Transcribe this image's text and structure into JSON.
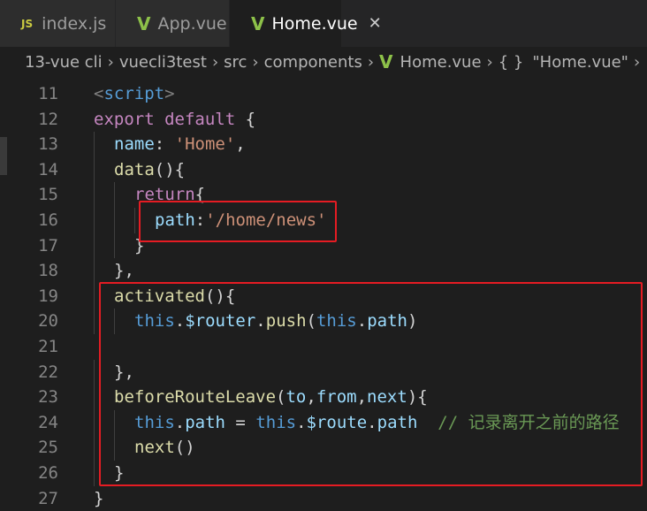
{
  "tabs": [
    {
      "label": "index.js",
      "icon": "js-file-icon",
      "icon_text": "JS",
      "active": false
    },
    {
      "label": "App.vue",
      "icon": "vue-file-icon",
      "active": false
    },
    {
      "label": "Home.vue",
      "icon": "vue-file-icon",
      "active": true,
      "close": "✕"
    }
  ],
  "breadcrumb": {
    "items": [
      "13-vue cli",
      "vuecli3test",
      "src",
      "components",
      "Home.vue",
      "\"Home.vue\""
    ],
    "separator": "›",
    "object_icon_text": "{ }"
  },
  "code": {
    "lines": [
      {
        "n": "11",
        "indent": 0,
        "t": [
          [
            "br",
            "<"
          ],
          [
            "tag",
            "script"
          ],
          [
            "br",
            ">"
          ]
        ]
      },
      {
        "n": "12",
        "indent": 0,
        "t": [
          [
            "kw",
            "export"
          ],
          [
            "p",
            " "
          ],
          [
            "kw",
            "default"
          ],
          [
            "p",
            " {"
          ]
        ]
      },
      {
        "n": "13",
        "indent": 1,
        "t": [
          [
            "prop",
            "name"
          ],
          [
            "p",
            ": "
          ],
          [
            "str",
            "'Home'"
          ],
          [
            "p",
            ","
          ]
        ]
      },
      {
        "n": "14",
        "indent": 1,
        "t": [
          [
            "fn",
            "data"
          ],
          [
            "p",
            "(){"
          ]
        ]
      },
      {
        "n": "15",
        "indent": 2,
        "t": [
          [
            "kw",
            "return"
          ],
          [
            "p",
            "{"
          ]
        ]
      },
      {
        "n": "16",
        "indent": 3,
        "t": [
          [
            "prop",
            "path"
          ],
          [
            "p",
            ":"
          ],
          [
            "str",
            "'/home/news'"
          ]
        ]
      },
      {
        "n": "17",
        "indent": 2,
        "t": [
          [
            "p",
            "}"
          ]
        ]
      },
      {
        "n": "18",
        "indent": 1,
        "t": [
          [
            "p",
            "},"
          ]
        ]
      },
      {
        "n": "19",
        "indent": 1,
        "t": [
          [
            "fn",
            "activated"
          ],
          [
            "p",
            "(){"
          ]
        ]
      },
      {
        "n": "20",
        "indent": 2,
        "t": [
          [
            "this",
            "this"
          ],
          [
            "p",
            "."
          ],
          [
            "prop",
            "$router"
          ],
          [
            "p",
            "."
          ],
          [
            "fn",
            "push"
          ],
          [
            "p",
            "("
          ],
          [
            "this",
            "this"
          ],
          [
            "p",
            "."
          ],
          [
            "prop",
            "path"
          ],
          [
            "p",
            ")"
          ]
        ]
      },
      {
        "n": "21",
        "indent": 0,
        "t": []
      },
      {
        "n": "22",
        "indent": 1,
        "t": [
          [
            "p",
            "},"
          ]
        ]
      },
      {
        "n": "23",
        "indent": 1,
        "t": [
          [
            "fn",
            "beforeRouteLeave"
          ],
          [
            "p",
            "("
          ],
          [
            "prop",
            "to"
          ],
          [
            "p",
            ","
          ],
          [
            "prop",
            "from"
          ],
          [
            "p",
            ","
          ],
          [
            "prop",
            "next"
          ],
          [
            "p",
            "){"
          ]
        ]
      },
      {
        "n": "24",
        "indent": 2,
        "t": [
          [
            "this",
            "this"
          ],
          [
            "p",
            "."
          ],
          [
            "prop",
            "path"
          ],
          [
            "p",
            " = "
          ],
          [
            "this",
            "this"
          ],
          [
            "p",
            "."
          ],
          [
            "prop",
            "$route"
          ],
          [
            "p",
            "."
          ],
          [
            "prop",
            "path"
          ],
          [
            "p",
            "  "
          ],
          [
            "cm",
            "// 记录离开之前的路径"
          ]
        ]
      },
      {
        "n": "25",
        "indent": 2,
        "t": [
          [
            "fn",
            "next"
          ],
          [
            "p",
            "()"
          ]
        ]
      },
      {
        "n": "26",
        "indent": 1,
        "t": [
          [
            "p",
            "}"
          ]
        ]
      },
      {
        "n": "27",
        "indent": 0,
        "t": [
          [
            "p",
            "}"
          ]
        ]
      }
    ]
  }
}
